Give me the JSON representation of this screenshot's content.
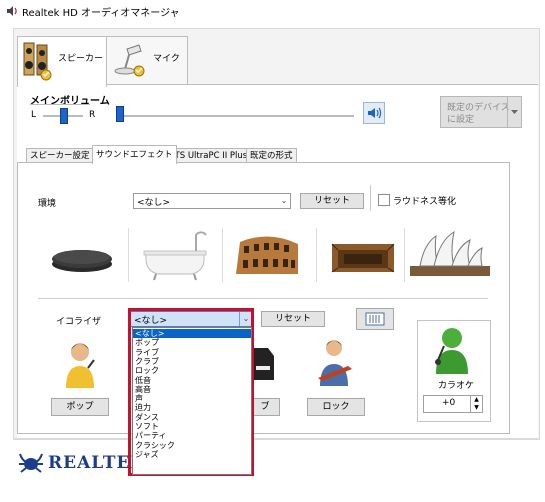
{
  "window": {
    "title": "Realtek HD オーディオマネージャ"
  },
  "device_tabs": [
    {
      "label": "スピーカー",
      "icon": "speaker-device-icon",
      "active": true
    },
    {
      "label": "マイク",
      "icon": "microphone-device-icon",
      "active": false
    }
  ],
  "main_volume": {
    "title": "メインボリューム",
    "left_label": "L",
    "right_label": "R",
    "balance_level": 0.5,
    "volume_level": 0.0
  },
  "default_device": {
    "line1": "既定のデバイス",
    "line2": "に設定"
  },
  "sub_tabs": [
    {
      "label": "スピーカー設定",
      "active": false
    },
    {
      "label": "サウンドエフェクト",
      "active": true
    },
    {
      "label": "DTS UltraPC II Plus",
      "active": false
    },
    {
      "label": "既定の形式",
      "active": false
    }
  ],
  "environment": {
    "label": "環境",
    "value": "<なし>",
    "reset_label": "リセット",
    "loudness_label": "ラウドネス等化",
    "loudness_checked": false,
    "presets": [
      "stone-icon",
      "bathtub-icon",
      "colosseum-icon",
      "arena-icon",
      "opera-house-icon"
    ]
  },
  "equalizer": {
    "label": "イコライザ",
    "value": "<なし>",
    "reset_label": "リセット",
    "dropdown_options": [
      "<なし>",
      "ポップ",
      "ライブ",
      "クラブ",
      "ロック",
      "低音",
      "高音",
      "声",
      "迫力",
      "ダンス",
      "ソフト",
      "パーティ",
      "クラシック",
      "ジャズ"
    ],
    "selected_index": 0,
    "preset_buttons": [
      "ポップ",
      "ブ",
      "ロック"
    ]
  },
  "karaoke": {
    "label": "カラオケ",
    "value": "+0"
  },
  "brand": {
    "name": "REALTEK"
  },
  "colors": {
    "accent": "#1e63c8",
    "highlight": "#c8102e",
    "selection": "#0a64c8"
  }
}
